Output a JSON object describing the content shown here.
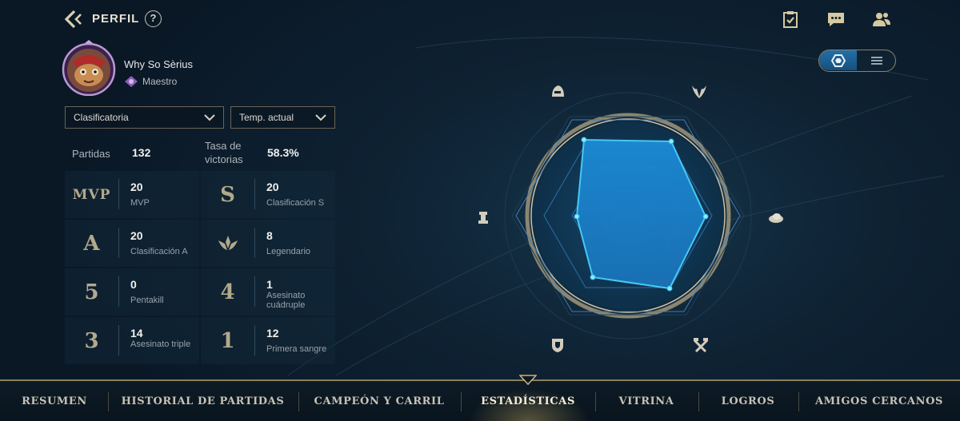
{
  "header": {
    "title": "PERFIL",
    "help_label": "?"
  },
  "profile": {
    "name": "Why So Sèrius",
    "rank": "Maestro"
  },
  "filters": {
    "mode": "Clasificatoria",
    "season": "Temp. actual"
  },
  "summary": {
    "matches_label": "Partidas",
    "matches_value": "132",
    "winrate_label_1": "Tasa de",
    "winrate_label_2": "victorias",
    "winrate_value": "58.3%"
  },
  "stats": [
    {
      "glyph": "MVP",
      "value": "20",
      "label": "MVP"
    },
    {
      "glyph": "S",
      "value": "20",
      "label": "Clasificación S"
    },
    {
      "glyph": "A",
      "value": "20",
      "label": "Clasificación A"
    },
    {
      "glyph": "",
      "value": "8",
      "label": "Legendario"
    },
    {
      "glyph": "5",
      "value": "0",
      "label": "Pentakill"
    },
    {
      "glyph": "4",
      "value": "1",
      "label": "Asesinato cuádruple"
    },
    {
      "glyph": "3",
      "value": "14",
      "label": "Asesinato triple"
    },
    {
      "glyph": "1",
      "value": "12",
      "label": "Primera sangre"
    }
  ],
  "radar_icons": [
    "fighter-helmet-icon",
    "horned-mask-icon",
    "hat-icon",
    "chess-rook-icon",
    "shield-icon",
    "crossed-tools-icon"
  ],
  "nav": {
    "tabs": [
      "RESUMEN",
      "HISTORIAL DE PARTIDAS",
      "CAMPEÓN Y CARRIL",
      "ESTADÍSTICAS",
      "VITRINA",
      "LOGROS",
      "AMIGOS CERCANOS"
    ],
    "active": "ESTADÍSTICAS"
  },
  "colors": {
    "accent_gold": "#c8aa6e",
    "radar_fill": "#1e8fd8",
    "radar_point": "#7ee8ff"
  }
}
